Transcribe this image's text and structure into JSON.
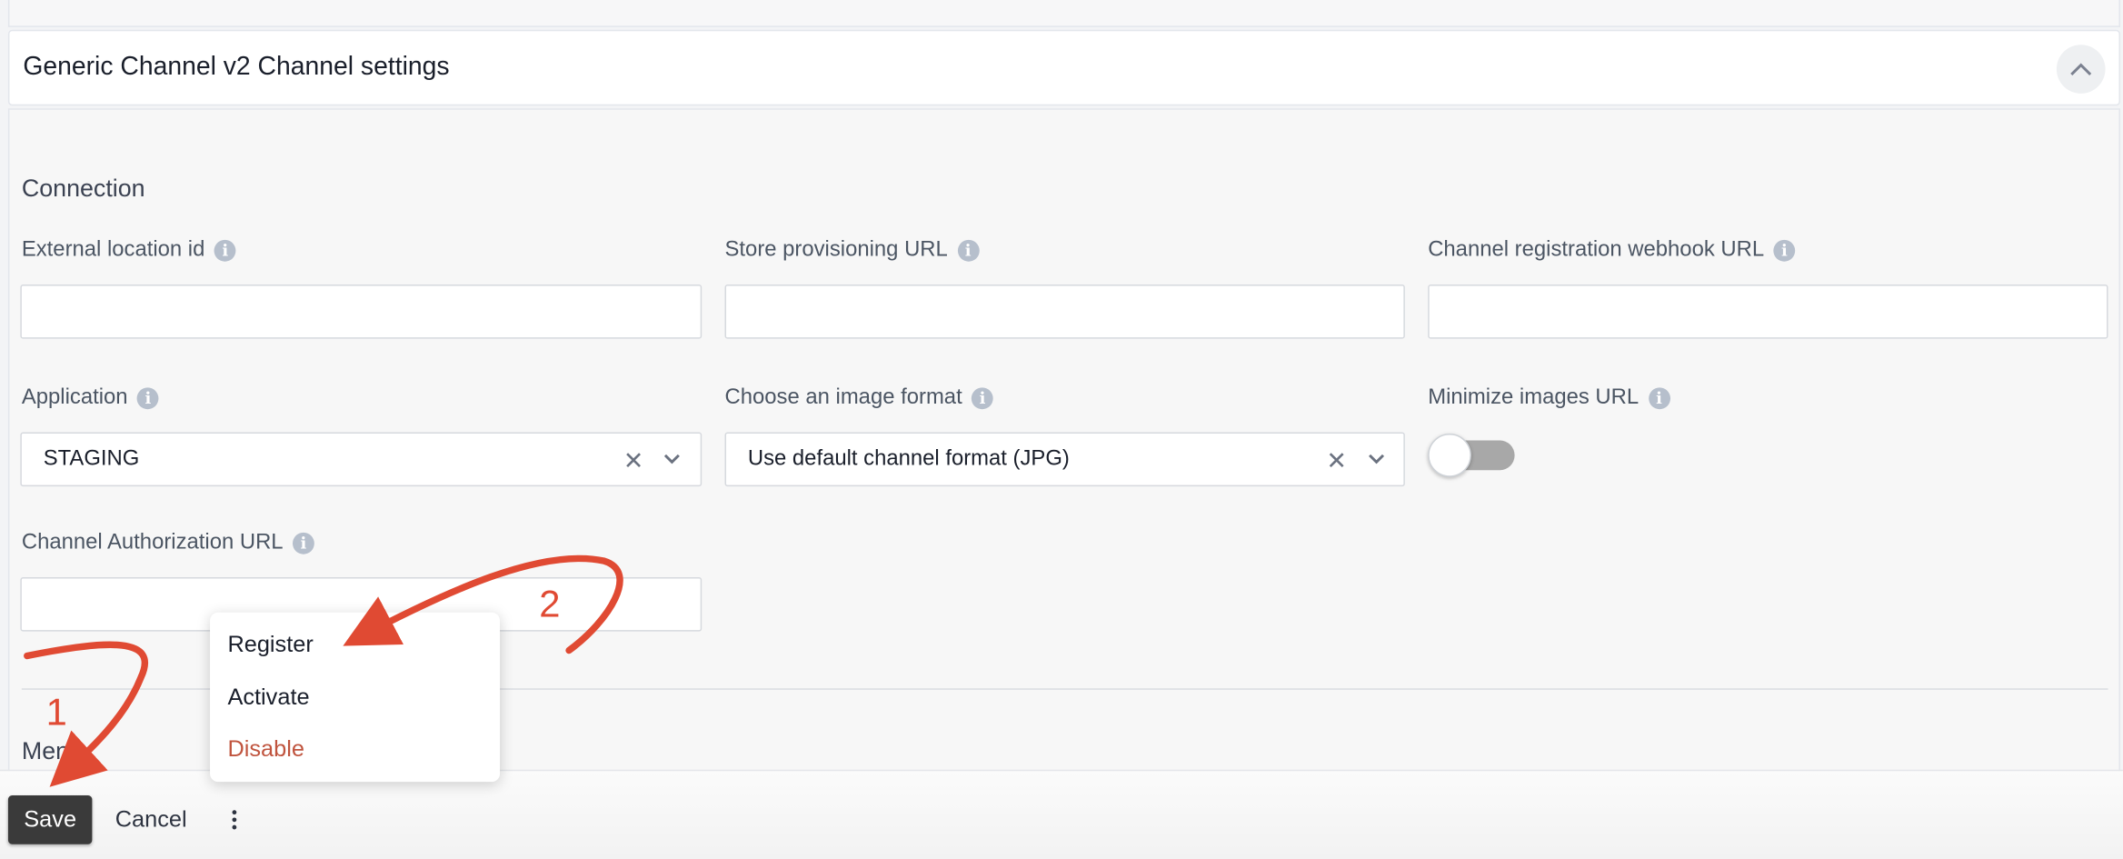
{
  "panel": {
    "title": "Generic Channel v2 Channel settings"
  },
  "connection": {
    "section_title": "Connection",
    "fields": {
      "external_location_id": {
        "label": "External location id",
        "value": ""
      },
      "store_provisioning_url": {
        "label": "Store provisioning URL",
        "value": ""
      },
      "channel_registration_webhook_url": {
        "label": "Channel registration webhook URL",
        "value": ""
      },
      "application": {
        "label": "Application",
        "selected": "STAGING"
      },
      "image_format": {
        "label": "Choose an image format",
        "selected": "Use default channel format (JPG)"
      },
      "minimize_images_url": {
        "label": "Minimize images URL",
        "enabled": false
      },
      "channel_authorization_url": {
        "label": "Channel Authorization URL",
        "value": ""
      }
    }
  },
  "next_section": {
    "title_partial": "Menu"
  },
  "footer": {
    "save_label": "Save",
    "cancel_label": "Cancel"
  },
  "more_menu": {
    "items": [
      {
        "label": "Register"
      },
      {
        "label": "Activate"
      },
      {
        "label": "Disable"
      }
    ]
  },
  "annotations": {
    "step1": "1",
    "step2": "2",
    "arrow_color": "#e04a33"
  },
  "icons": {
    "info": "info-icon",
    "clear": "clear-icon",
    "chevron_down": "chevron-down-icon",
    "chevron_up": "chevron-up-icon",
    "more": "more-vertical-icon"
  },
  "colors": {
    "save_button_bg": "#3a3a3a",
    "danger_text": "#c0543e",
    "toggle_off": "#a8a8a8"
  }
}
